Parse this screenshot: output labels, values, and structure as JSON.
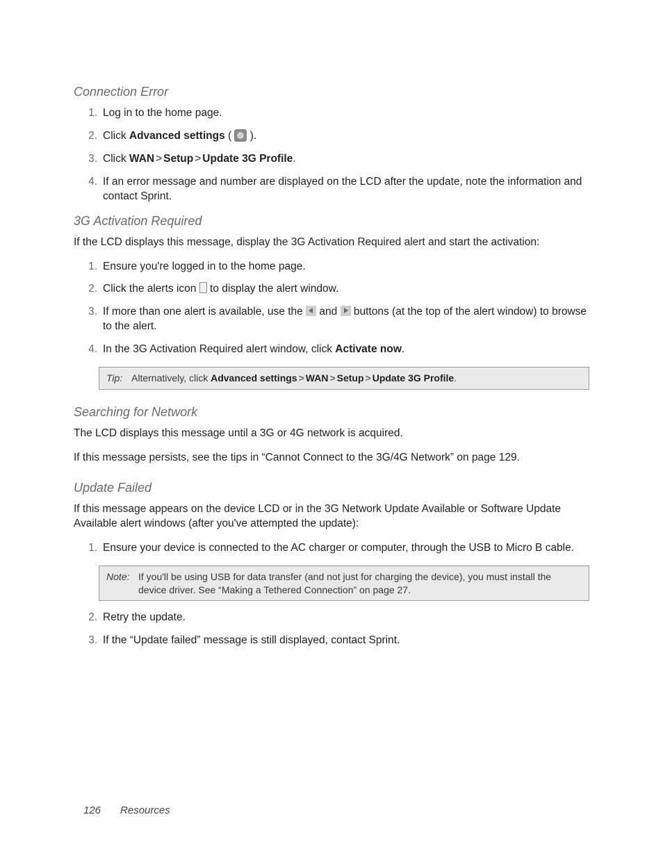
{
  "section1": {
    "title": "Connection Error",
    "steps": {
      "s1": "Log in to the home page.",
      "s2a": "Click ",
      "s2b": "Advanced settings",
      "s2c": " ( ",
      "s2d": " ).",
      "s3a": "Click ",
      "s3b": "WAN",
      "s3c": "Setup",
      "s3d": "Update 3G Profile",
      "s4": "If an error message and number are displayed on the LCD after the update, note the information and contact Sprint."
    }
  },
  "section2": {
    "title": "3G Activation Required",
    "intro": "If the LCD displays this message, display the 3G Activation Required alert and start the activation:",
    "steps": {
      "s1": "Ensure you're logged in to the home page.",
      "s2a": "Click the alerts icon ",
      "s2b": " to display the alert window.",
      "s3a": "If more than one alert is available, use the ",
      "s3b": " and ",
      "s3c": " buttons (at the top of the alert window) to browse to the alert.",
      "s4a": "In the 3G Activation Required alert window, click ",
      "s4b": "Activate now"
    },
    "tip": {
      "label": "Tip:",
      "a": "Alternatively, click ",
      "b": "Advanced settings",
      "c": "WAN",
      "d": "Setup",
      "e": "Update 3G Profile"
    }
  },
  "section3": {
    "title": "Searching for Network",
    "p1": "The LCD displays this message until a 3G or 4G network is acquired.",
    "p2": "If this message persists, see the tips in “Cannot Connect to the 3G/4G Network” on page 129."
  },
  "section4": {
    "title": "Update Failed",
    "intro": "If this message appears on the device LCD or in the 3G Network Update Available or Software Update Available alert windows (after you've attempted the update):",
    "steps": {
      "s1": "Ensure your device is connected to the AC charger or computer, through the USB to Micro B cable.",
      "s2": "Retry the update.",
      "s3": "If the “Update failed” message is still displayed, contact Sprint."
    },
    "note": {
      "label": "Note:",
      "text": "If you'll be using USB for data transfer (and not just for charging the device), you must install the device driver. See “Making a Tethered Connection” on page 27."
    }
  },
  "footer": {
    "page": "126",
    "section": "Resources"
  },
  "gt": ">"
}
